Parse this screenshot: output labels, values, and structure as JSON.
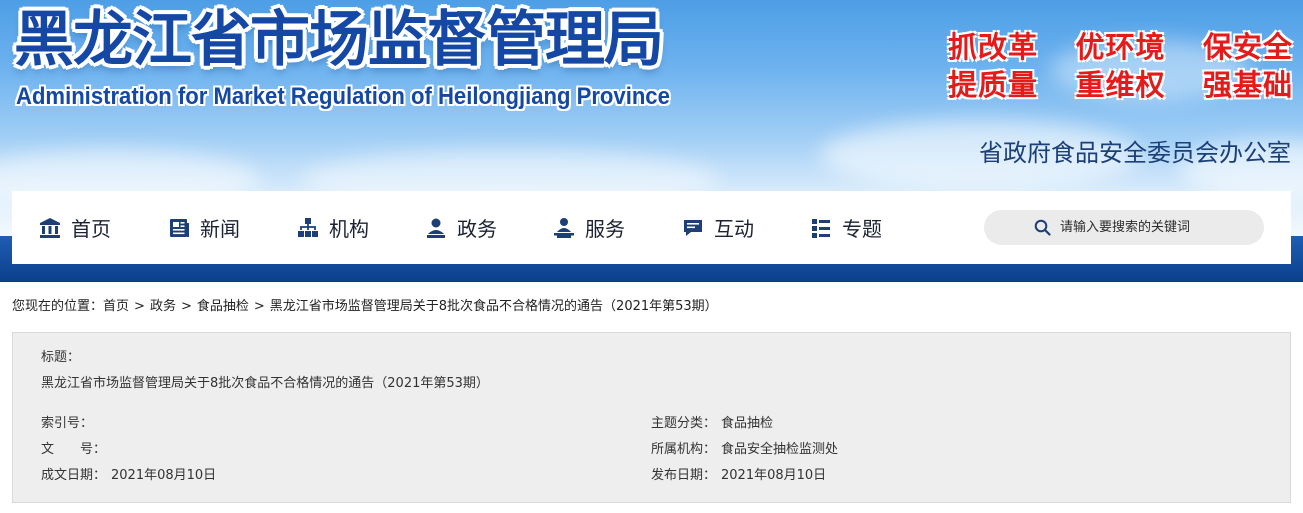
{
  "header": {
    "title_cn": "黑龙江省市场监督管理局",
    "title_en": "Administration for Market Regulation of Heilongjiang Province",
    "slogans": [
      [
        "抓改革",
        "优环境",
        "保安全"
      ],
      [
        "提质量",
        "重维权",
        "强基础"
      ]
    ],
    "office": "省政府食品安全委员会办公室",
    "colors": {
      "title": "#1548a5",
      "slogan": "#e51b1b",
      "band": "#0b3f8c"
    }
  },
  "nav": {
    "items": [
      {
        "label": "首页",
        "icon": "bank-icon"
      },
      {
        "label": "新闻",
        "icon": "newspaper-icon"
      },
      {
        "label": "机构",
        "icon": "org-chart-icon"
      },
      {
        "label": "政务",
        "icon": "user-desk-icon"
      },
      {
        "label": "服务",
        "icon": "service-person-icon"
      },
      {
        "label": "互动",
        "icon": "chat-icon"
      },
      {
        "label": "专题",
        "icon": "list-icon"
      }
    ],
    "search_placeholder": "请输入要搜索的关键词"
  },
  "breadcrumb": {
    "prefix": "您现在的位置：",
    "items": [
      "首页",
      "政务",
      "食品抽检"
    ],
    "separator": ">",
    "current": "黑龙江省市场监督管理局关于8批次食品不合格情况的通告（2021年第53期）"
  },
  "info": {
    "title_label": "标题：",
    "title_value": "黑龙江省市场监督管理局关于8批次食品不合格情况的通告（2021年第53期）",
    "index_label": "索引号：",
    "index_value": "",
    "docno_label": "文　　号：",
    "docno_value": "",
    "written_label": "成文日期：",
    "written_value": "2021年08月10日",
    "topic_label": "主题分类：",
    "topic_value": "食品抽检",
    "org_label": "所属机构：",
    "org_value": "食品安全抽检监测处",
    "published_label": "发布日期：",
    "published_value": "2021年08月10日"
  }
}
